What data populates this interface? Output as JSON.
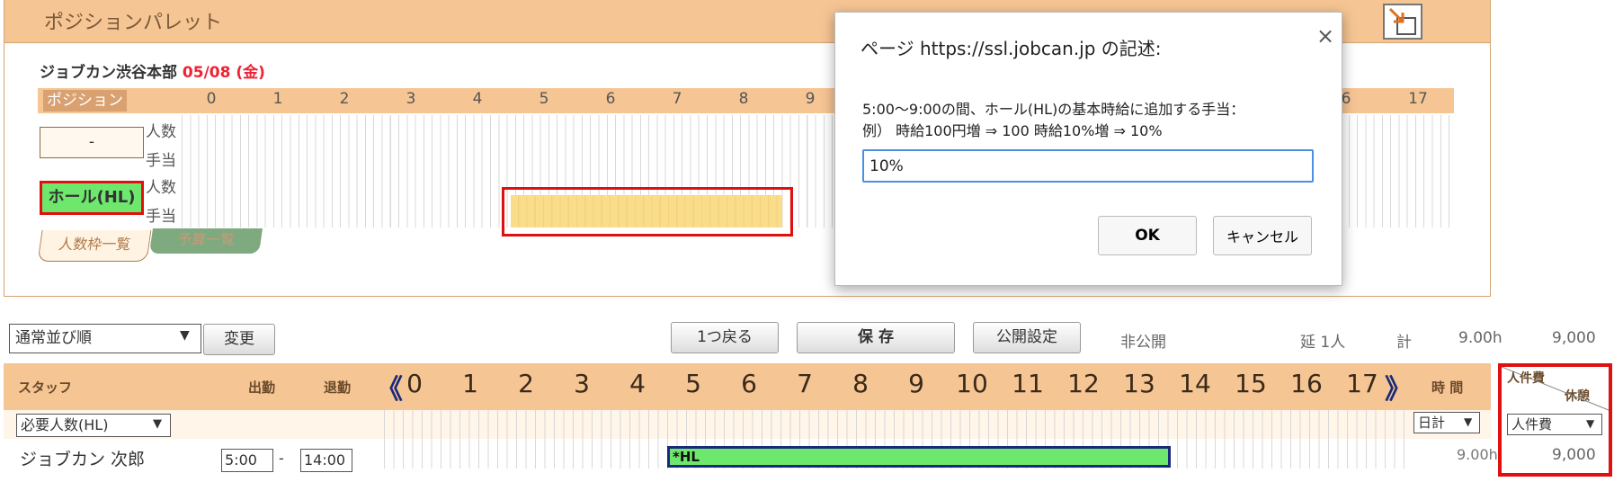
{
  "palette": {
    "title": "ポジションパレット",
    "store_name": "ジョブカン渋谷本部",
    "date": "05/08 (金)",
    "position_header": "ポジション",
    "hours_left": [
      "0",
      "1",
      "2",
      "3",
      "4",
      "5",
      "6",
      "7",
      "8",
      "9"
    ],
    "hours_right": [
      "6",
      "17"
    ],
    "rows": [
      {
        "position": "-",
        "labels": [
          "人数",
          "手当"
        ]
      },
      {
        "position": "ホール(HL)",
        "labels": [
          "人数",
          "手当"
        ]
      }
    ],
    "tabs": [
      "人数枠一覧",
      "予算一覧"
    ]
  },
  "dialog": {
    "title": "ページ https://ssl.jobcan.jp の記述:",
    "message_line1": "5:00～9:00の間、ホール(HL)の基本時給に追加する手当：",
    "message_line2": "例） 時給100円増 ⇒ 100  時給10%増 ⇒ 10%",
    "input_value": "10%",
    "ok_label": "OK",
    "cancel_label": "キャンセル",
    "close_symbol": "×"
  },
  "toolbar": {
    "sort_value": "通常並び順",
    "change_label": "変更",
    "undo_label": "1つ戻る",
    "save_label": "保 存",
    "publish_label": "公開設定",
    "publish_status": "非公開",
    "total_people": "延 1人",
    "total_label": "計",
    "total_hours": "9.00h",
    "total_cost": "9,000"
  },
  "schedule": {
    "staff_header": "スタッフ",
    "start_header": "出勤",
    "end_header": "退勤",
    "prev_symbol": "《",
    "next_symbol": "》",
    "hours": [
      "0",
      "1",
      "2",
      "3",
      "4",
      "5",
      "6",
      "7",
      "8",
      "9",
      "10",
      "11",
      "12",
      "13",
      "14",
      "15",
      "16",
      "17"
    ],
    "time_header": "時 間",
    "cost_header": "人件費",
    "break_header": "休憩",
    "req_select": "必要人数(HL)",
    "day_total_select": "日計",
    "cost_select": "人件費",
    "staff": [
      {
        "name": "ジョブカン 次郎",
        "start": "5:00",
        "dash": "-",
        "end": "14:00",
        "shift_label": "*HL",
        "hours": "9.00h",
        "cost": "9,000"
      }
    ]
  },
  "colors": {
    "header_bg": "#f6c594",
    "highlight_red": "#e01010",
    "shift_green": "#6de86d",
    "allowance_yellow": "#f9dd8a"
  }
}
